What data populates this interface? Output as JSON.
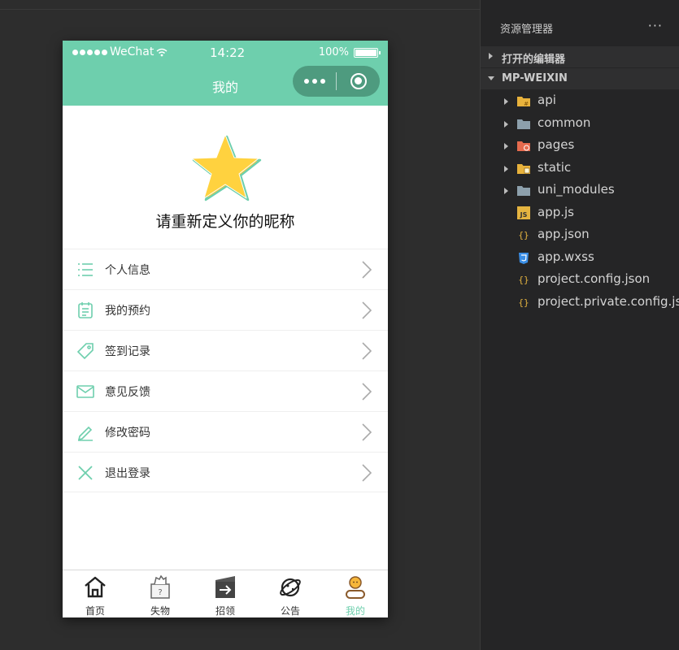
{
  "status_bar": {
    "carrier": "WeChat",
    "time": "14:22",
    "battery": "100%"
  },
  "nav": {
    "title": "我的"
  },
  "profile": {
    "nickname": "请重新定义你的昵称"
  },
  "menu": [
    {
      "label": "个人信息",
      "icon": "list-icon"
    },
    {
      "label": "我的预约",
      "icon": "clipboard-icon"
    },
    {
      "label": "签到记录",
      "icon": "tag-icon"
    },
    {
      "label": "意见反馈",
      "icon": "mail-icon"
    },
    {
      "label": "修改密码",
      "icon": "pencil-icon"
    },
    {
      "label": "退出登录",
      "icon": "x-icon"
    }
  ],
  "tabbar": [
    {
      "label": "首页",
      "icon": "home-icon"
    },
    {
      "label": "失物",
      "icon": "lost-item-icon"
    },
    {
      "label": "招领",
      "icon": "claim-icon"
    },
    {
      "label": "公告",
      "icon": "planet-icon"
    },
    {
      "label": "我的",
      "icon": "user-icon",
      "active": true
    }
  ],
  "explorer": {
    "title": "资源管理器",
    "more": "···",
    "open_editors": "打开的编辑器",
    "project": "MP-WEIXIN",
    "items": [
      {
        "name": "api",
        "type": "folder",
        "icon": "api-folder-icon"
      },
      {
        "name": "common",
        "type": "folder",
        "icon": "folder-icon"
      },
      {
        "name": "pages",
        "type": "folder",
        "icon": "pages-folder-icon"
      },
      {
        "name": "static",
        "type": "folder",
        "icon": "static-folder-icon"
      },
      {
        "name": "uni_modules",
        "type": "folder",
        "icon": "folder-icon"
      },
      {
        "name": "app.js",
        "type": "file",
        "icon": "js-icon"
      },
      {
        "name": "app.json",
        "type": "file",
        "icon": "json-icon"
      },
      {
        "name": "app.wxss",
        "type": "file",
        "icon": "css-icon"
      },
      {
        "name": "project.config.json",
        "type": "file",
        "icon": "json-icon"
      },
      {
        "name": "project.private.config.js...",
        "type": "file",
        "icon": "json-icon"
      }
    ]
  },
  "colors": {
    "accent": "#6ecfad",
    "capsule": "#4e9b7f",
    "menu_icon": "#6ecfad",
    "folder_yellow": "#e8b23c",
    "folder_gray": "#8da0ac",
    "folder_red": "#e66b4e",
    "json_yellow": "#e5b440",
    "css_blue": "#3a8ee6"
  }
}
